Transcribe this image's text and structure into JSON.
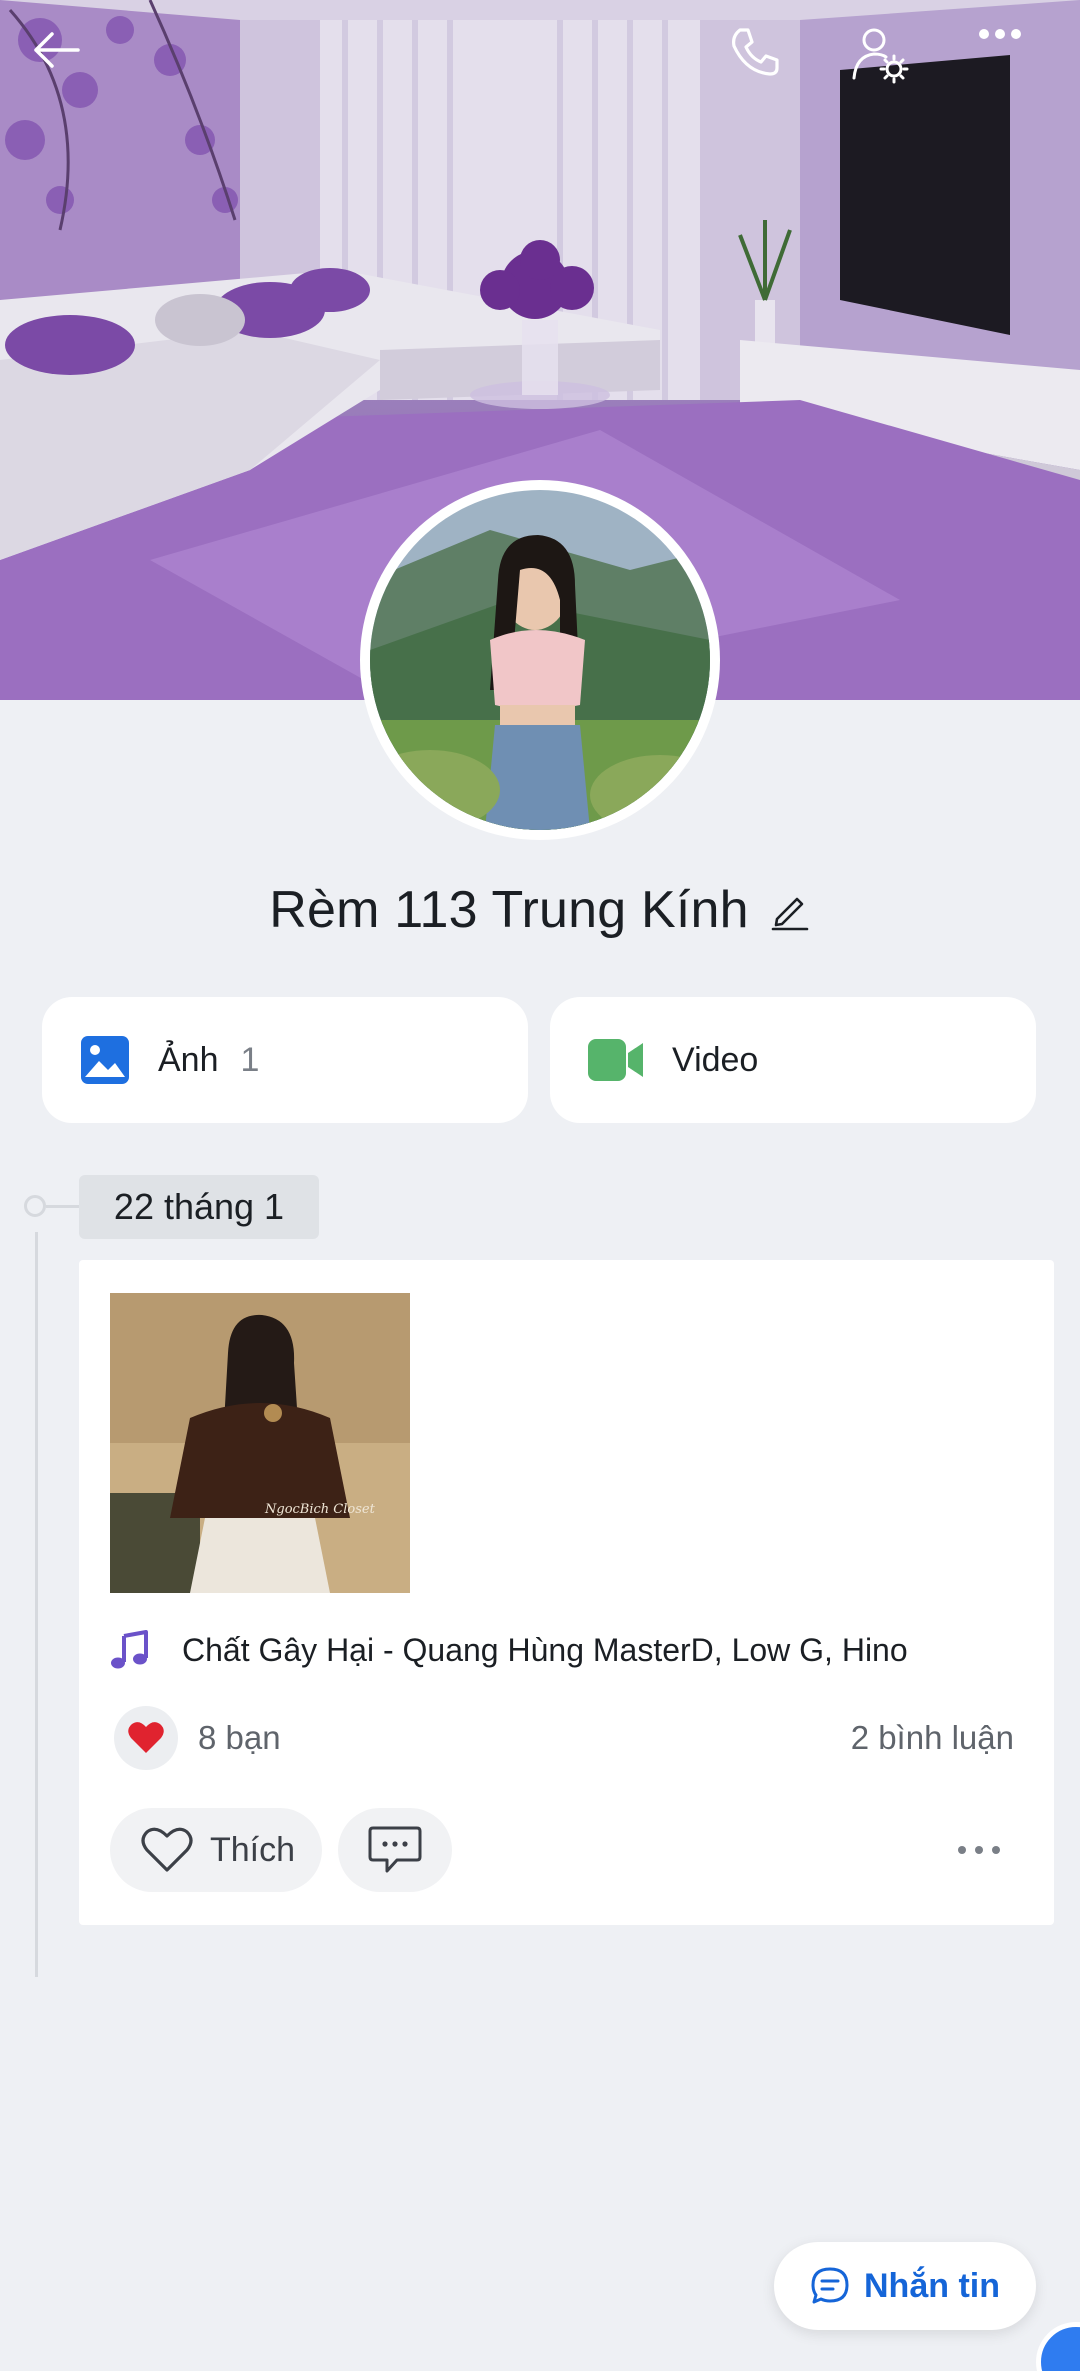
{
  "header": {
    "icons": [
      "back-arrow-icon",
      "phone-icon",
      "user-settings-icon",
      "more-icon"
    ]
  },
  "profile": {
    "name": "Rèm 113 Trung Kính"
  },
  "media_tiles": [
    {
      "label": "Ảnh",
      "count": "1",
      "icon": "photo-icon",
      "color": "#1e6fe0"
    },
    {
      "label": "Video",
      "icon": "video-icon",
      "color": "#56b46b"
    }
  ],
  "timeline": {
    "date": "22 tháng 1"
  },
  "post": {
    "music": "Chất Gây Hại - Quang Hùng MasterD, Low G, Hino",
    "reactions": "8 bạn",
    "comments": "2 bình luận",
    "like_label": "Thích",
    "photo_caption": "NgocBich Closet"
  },
  "actions": {
    "message_label": "Nhắn tin"
  },
  "colors": {
    "accent": "#1565d8",
    "background": "#eef0f4",
    "heart": "#e0232f",
    "music_icon": "#6b52c9"
  }
}
